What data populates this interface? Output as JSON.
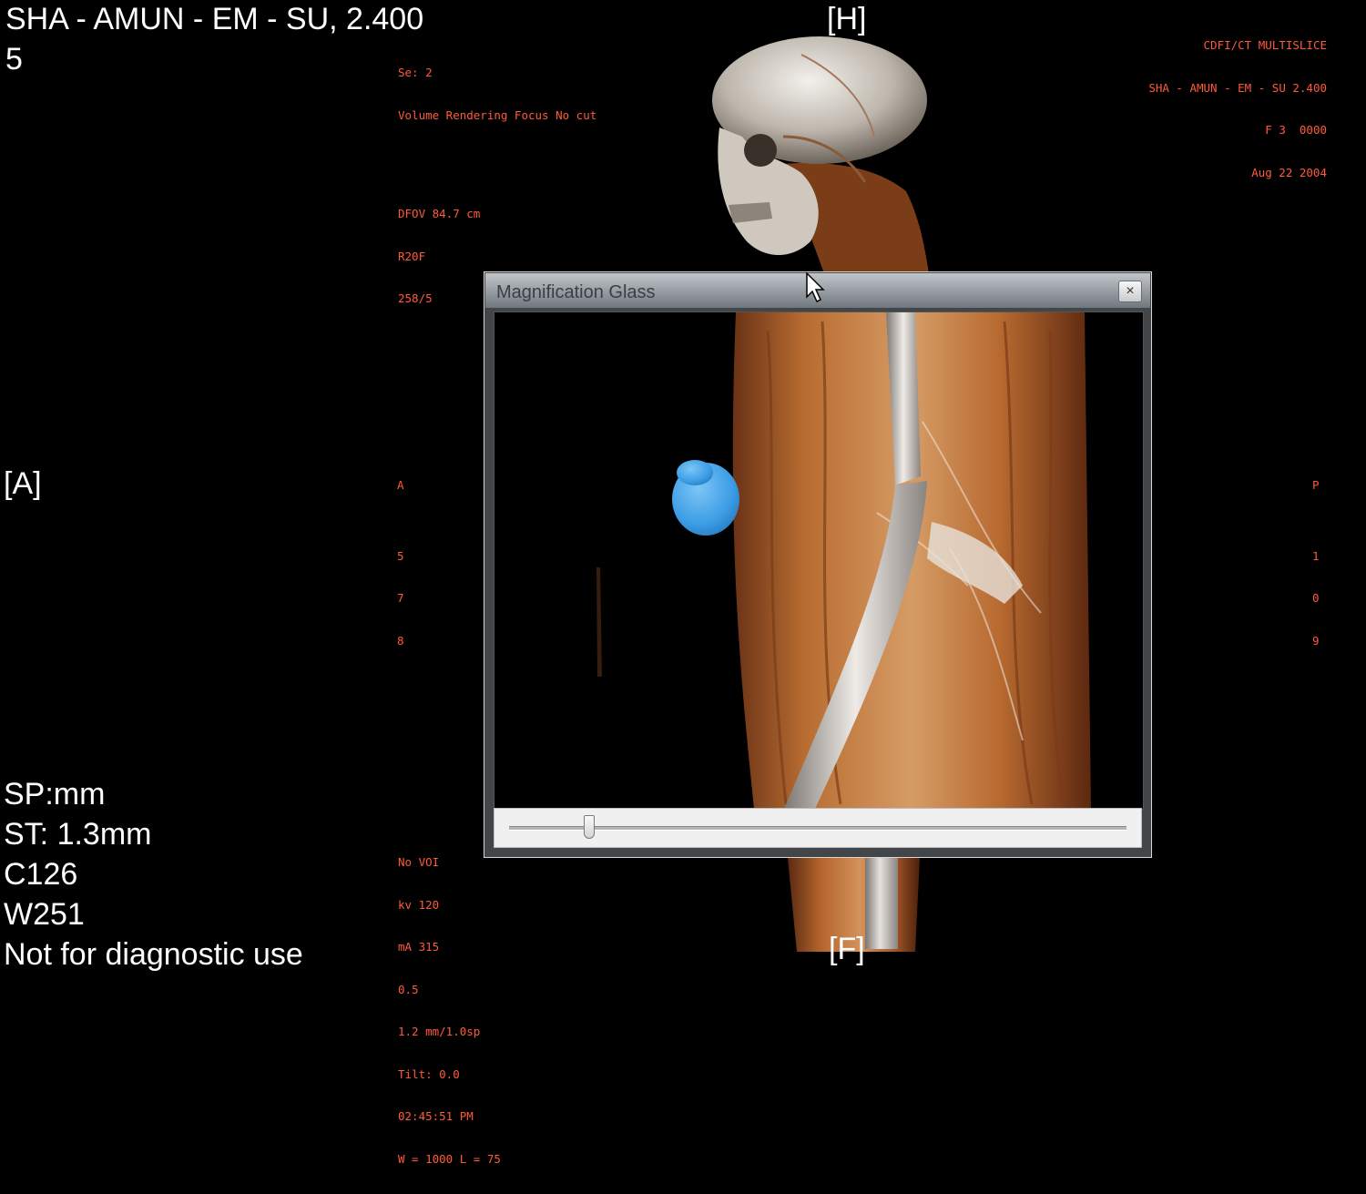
{
  "overlay": {
    "top_left": {
      "patient": "SHA - AMUN - EM - SU, 2.400",
      "line2": "5"
    },
    "top_center_small": [
      "Se: 2",
      "Volume Rendering Focus No cut",
      "",
      "",
      "DFOV 84.7 cm",
      "R20F",
      "258/5"
    ],
    "orientation": {
      "top": "[H]",
      "left": "[A]",
      "bottom": "[F]"
    },
    "top_right": [
      "CDFI/CT MULTISLICE",
      "SHA - AMUN - EM - SU 2.400",
      "F 3  0000",
      "Aug 22 2004"
    ],
    "left_scale": [
      "A",
      "",
      "5",
      "7",
      "8"
    ],
    "right_scale": [
      "P",
      "",
      "1",
      "0",
      "9"
    ],
    "bottom_left": [
      "SP:mm",
      "ST:  1.3mm",
      "C126",
      "W251",
      "Not for diagnostic use"
    ],
    "bottom_center_small": [
      "No VOI",
      "kv 120",
      "mA 315",
      "0.5",
      "1.2 mm/1.0sp",
      "Tilt: 0.0",
      "02:45:51 PM",
      "W = 1000 L = 75"
    ]
  },
  "mag_window": {
    "title": "Magnification Glass",
    "close_label": "×",
    "zoom_fraction": 0.13
  },
  "colors": {
    "overlay_text": "#ffffff",
    "annotation_text": "#ff5a3a",
    "highlight_object": "#4aa8ec"
  }
}
